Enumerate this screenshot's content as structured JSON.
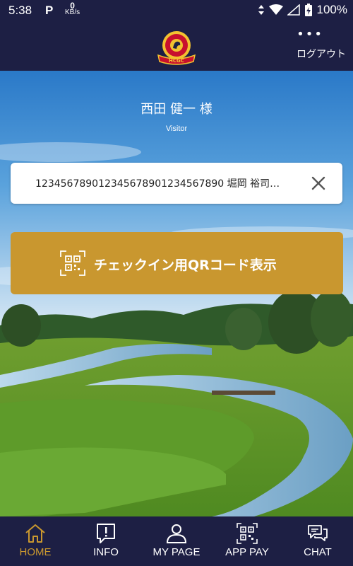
{
  "status_bar": {
    "time": "5:38",
    "app_indicator": "P",
    "net_speed_value": "0",
    "net_speed_unit": "KB/s",
    "battery_percent": "100%",
    "icons": [
      "wifi-icon",
      "signal-icon",
      "battery-icon"
    ]
  },
  "header": {
    "logo_icon": "hokkaido-classic-golf-club-logo",
    "logo_text": "HOKKAIDO CLASSIC G.C.",
    "logo_abbr": "HCGC",
    "menu_icon": "more-dots-icon",
    "logout_label": "ログアウト"
  },
  "user": {
    "name": "西田 健一 様",
    "role": "Visitor"
  },
  "card": {
    "text": "123456789012345678901234567890  堀岡 裕司…",
    "close_icon": "close-icon"
  },
  "qr_button": {
    "icon": "qr-code-icon",
    "label": "チェックイン用QRコード表示"
  },
  "bottom_nav": {
    "items": [
      {
        "label": "HOME",
        "icon": "home-icon",
        "active": true
      },
      {
        "label": "INFO",
        "icon": "info-icon",
        "active": false
      },
      {
        "label": "MY PAGE",
        "icon": "user-icon",
        "active": false
      },
      {
        "label": "APP PAY",
        "icon": "qr-code-icon",
        "active": false
      },
      {
        "label": "CHAT",
        "icon": "chat-icon",
        "active": false
      }
    ]
  },
  "colors": {
    "navy": "#1d1f44",
    "gold": "#c9972f",
    "white": "#ffffff"
  }
}
